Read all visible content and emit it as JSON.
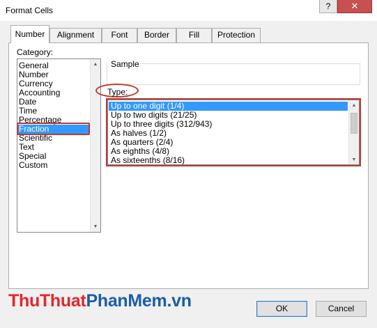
{
  "window": {
    "title": "Format Cells",
    "help": "?",
    "close": "✕"
  },
  "tabs": [
    {
      "label": "Number"
    },
    {
      "label": "Alignment"
    },
    {
      "label": "Font"
    },
    {
      "label": "Border"
    },
    {
      "label": "Fill"
    },
    {
      "label": "Protection"
    }
  ],
  "category": {
    "label": "Category:",
    "items": [
      "General",
      "Number",
      "Currency",
      "Accounting",
      "Date",
      "Time",
      "Percentage",
      "Fraction",
      "Scientific",
      "Text",
      "Special",
      "Custom"
    ],
    "selected": "Fraction"
  },
  "sample": {
    "label": "Sample",
    "value": ""
  },
  "type": {
    "label": "Type:",
    "items": [
      "Up to one digit (1/4)",
      "Up to two digits (21/25)",
      "Up to three digits (312/943)",
      "As halves (1/2)",
      "As quarters (2/4)",
      "As eighths (4/8)",
      "As sixteenths (8/16)"
    ],
    "selected": "Up to one digit (1/4)"
  },
  "buttons": {
    "ok": "OK",
    "cancel": "Cancel"
  },
  "watermark": {
    "part1": "ThuThuat",
    "part2": "PhanMem",
    "part3": ".vn"
  },
  "colors": {
    "selection": "#3399ff",
    "highlight": "#c0392b",
    "watermark_red": "#e3262e",
    "watermark_blue": "#1a5ea8"
  }
}
